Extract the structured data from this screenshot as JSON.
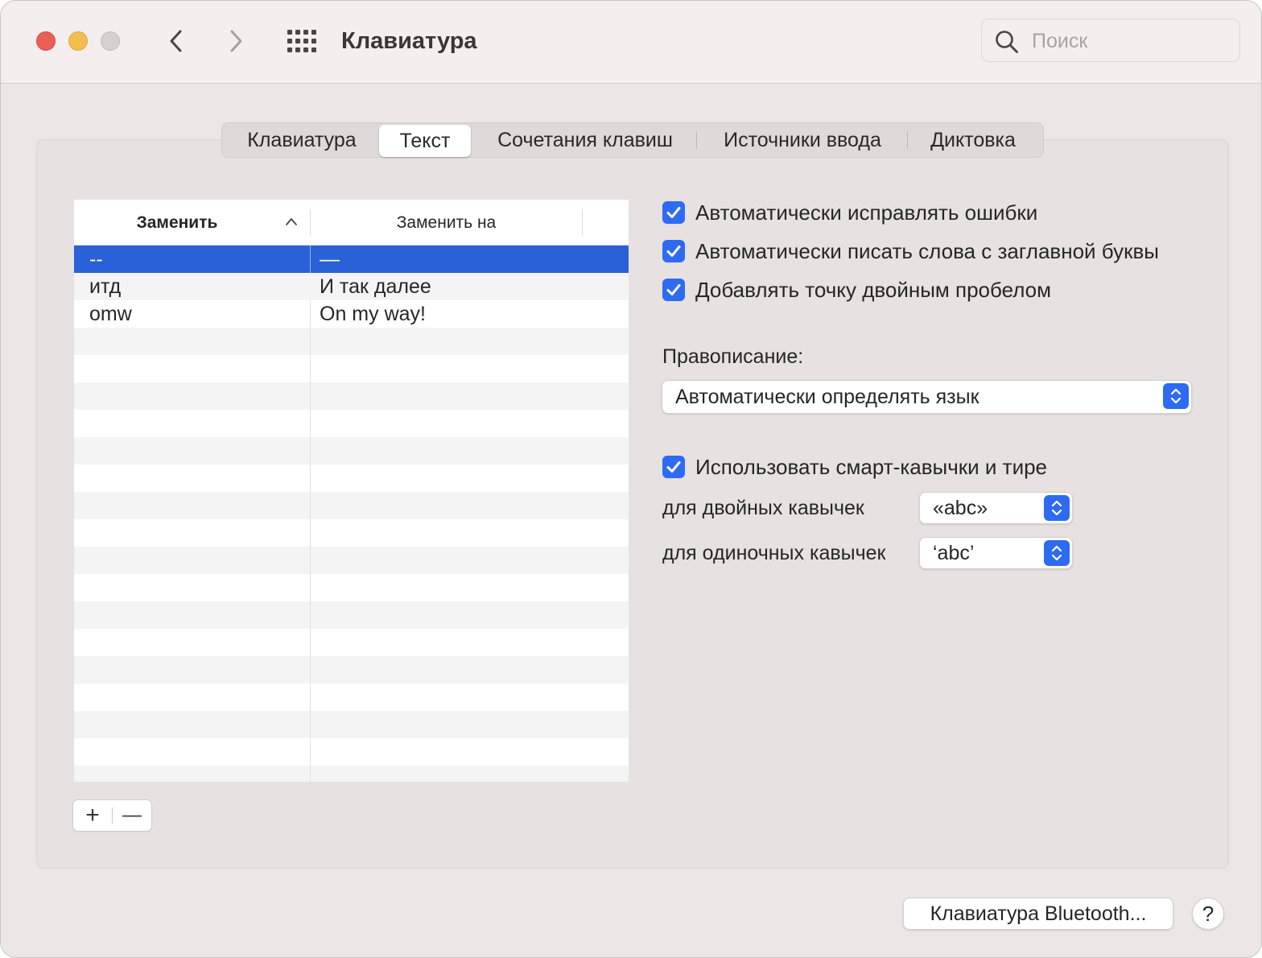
{
  "window": {
    "title": "Клавиатура",
    "search_placeholder": "Поиск"
  },
  "tabs": [
    {
      "label": "Клавиатура",
      "active": false
    },
    {
      "label": "Текст",
      "active": true
    },
    {
      "label": "Сочетания клавиш",
      "active": false
    },
    {
      "label": "Источники ввода",
      "active": false
    },
    {
      "label": "Диктовка",
      "active": false
    }
  ],
  "table": {
    "columns": [
      "Заменить",
      "Заменить на"
    ],
    "sort_column": "Заменить",
    "sort_direction": "ascending",
    "rows": [
      {
        "replace": "--",
        "with": "—",
        "selected": true
      },
      {
        "replace": "итд",
        "with": "И так далее",
        "selected": false
      },
      {
        "replace": "omw",
        "with": "On my way!",
        "selected": false
      }
    ]
  },
  "table_controls": {
    "add": "+",
    "remove": "—"
  },
  "options": {
    "autocorrect": {
      "label": "Автоматически исправлять ошибки",
      "checked": true
    },
    "capitalize": {
      "label": "Автоматически писать слова с заглавной буквы",
      "checked": true
    },
    "period": {
      "label": "Добавлять точку двойным пробелом",
      "checked": true
    }
  },
  "spelling": {
    "label": "Правописание:",
    "value": "Автоматически определять язык"
  },
  "smart_quotes": {
    "label": "Использовать смарт-кавычки и тире",
    "checked": true,
    "double_label": "для двойных кавычек",
    "double_value": "«abc»",
    "single_label": "для одиночных кавычек",
    "single_value": "‘abc’"
  },
  "footer": {
    "bluetooth_button": "Клавиатура Bluetooth...",
    "help_button": "?"
  },
  "colors": {
    "accent": "#2e6bf3",
    "selection": "#2a61d8",
    "close": "#ec5f58",
    "minimize": "#f4be4f",
    "zoom_inactive": "#d6d0d0"
  }
}
